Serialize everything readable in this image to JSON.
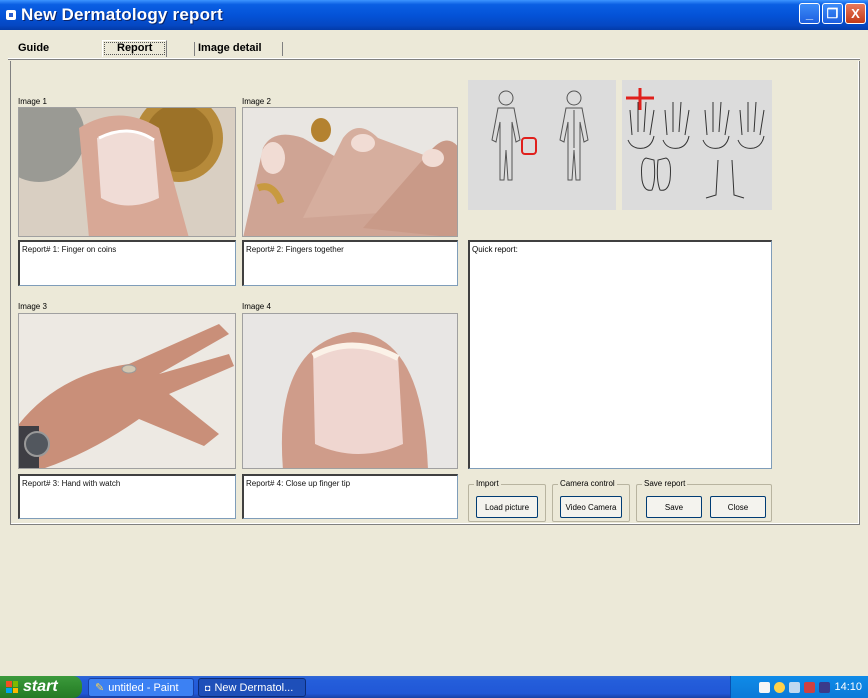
{
  "window": {
    "title": "New Dermatology report",
    "minimize": "_",
    "maximize": "❐",
    "close": "X"
  },
  "tabs": [
    {
      "label": "Guide"
    },
    {
      "label": "Report"
    },
    {
      "label": "Image detail"
    }
  ],
  "images": [
    {
      "label": "Image 1",
      "report": "Report# 1: Finger on coins"
    },
    {
      "label": "Image 2",
      "report": "Report# 2: Fingers together"
    },
    {
      "label": "Image 3",
      "report": "Report# 3: Hand with watch"
    },
    {
      "label": "Image 4",
      "report": "Report# 4: Close up finger tip"
    }
  ],
  "quick_report": {
    "label": "Quick report:"
  },
  "groups": {
    "import": {
      "label": "Import",
      "button": "Load picture"
    },
    "camera": {
      "label": "Camera control",
      "button": "Video Camera"
    },
    "save": {
      "label": "Save report",
      "save_button": "Save",
      "close_button": "Close"
    }
  },
  "taskbar": {
    "start": "start",
    "tasks": [
      {
        "label": "untitled - Paint"
      },
      {
        "label": "New Dermatol..."
      }
    ],
    "clock": "14:10"
  }
}
